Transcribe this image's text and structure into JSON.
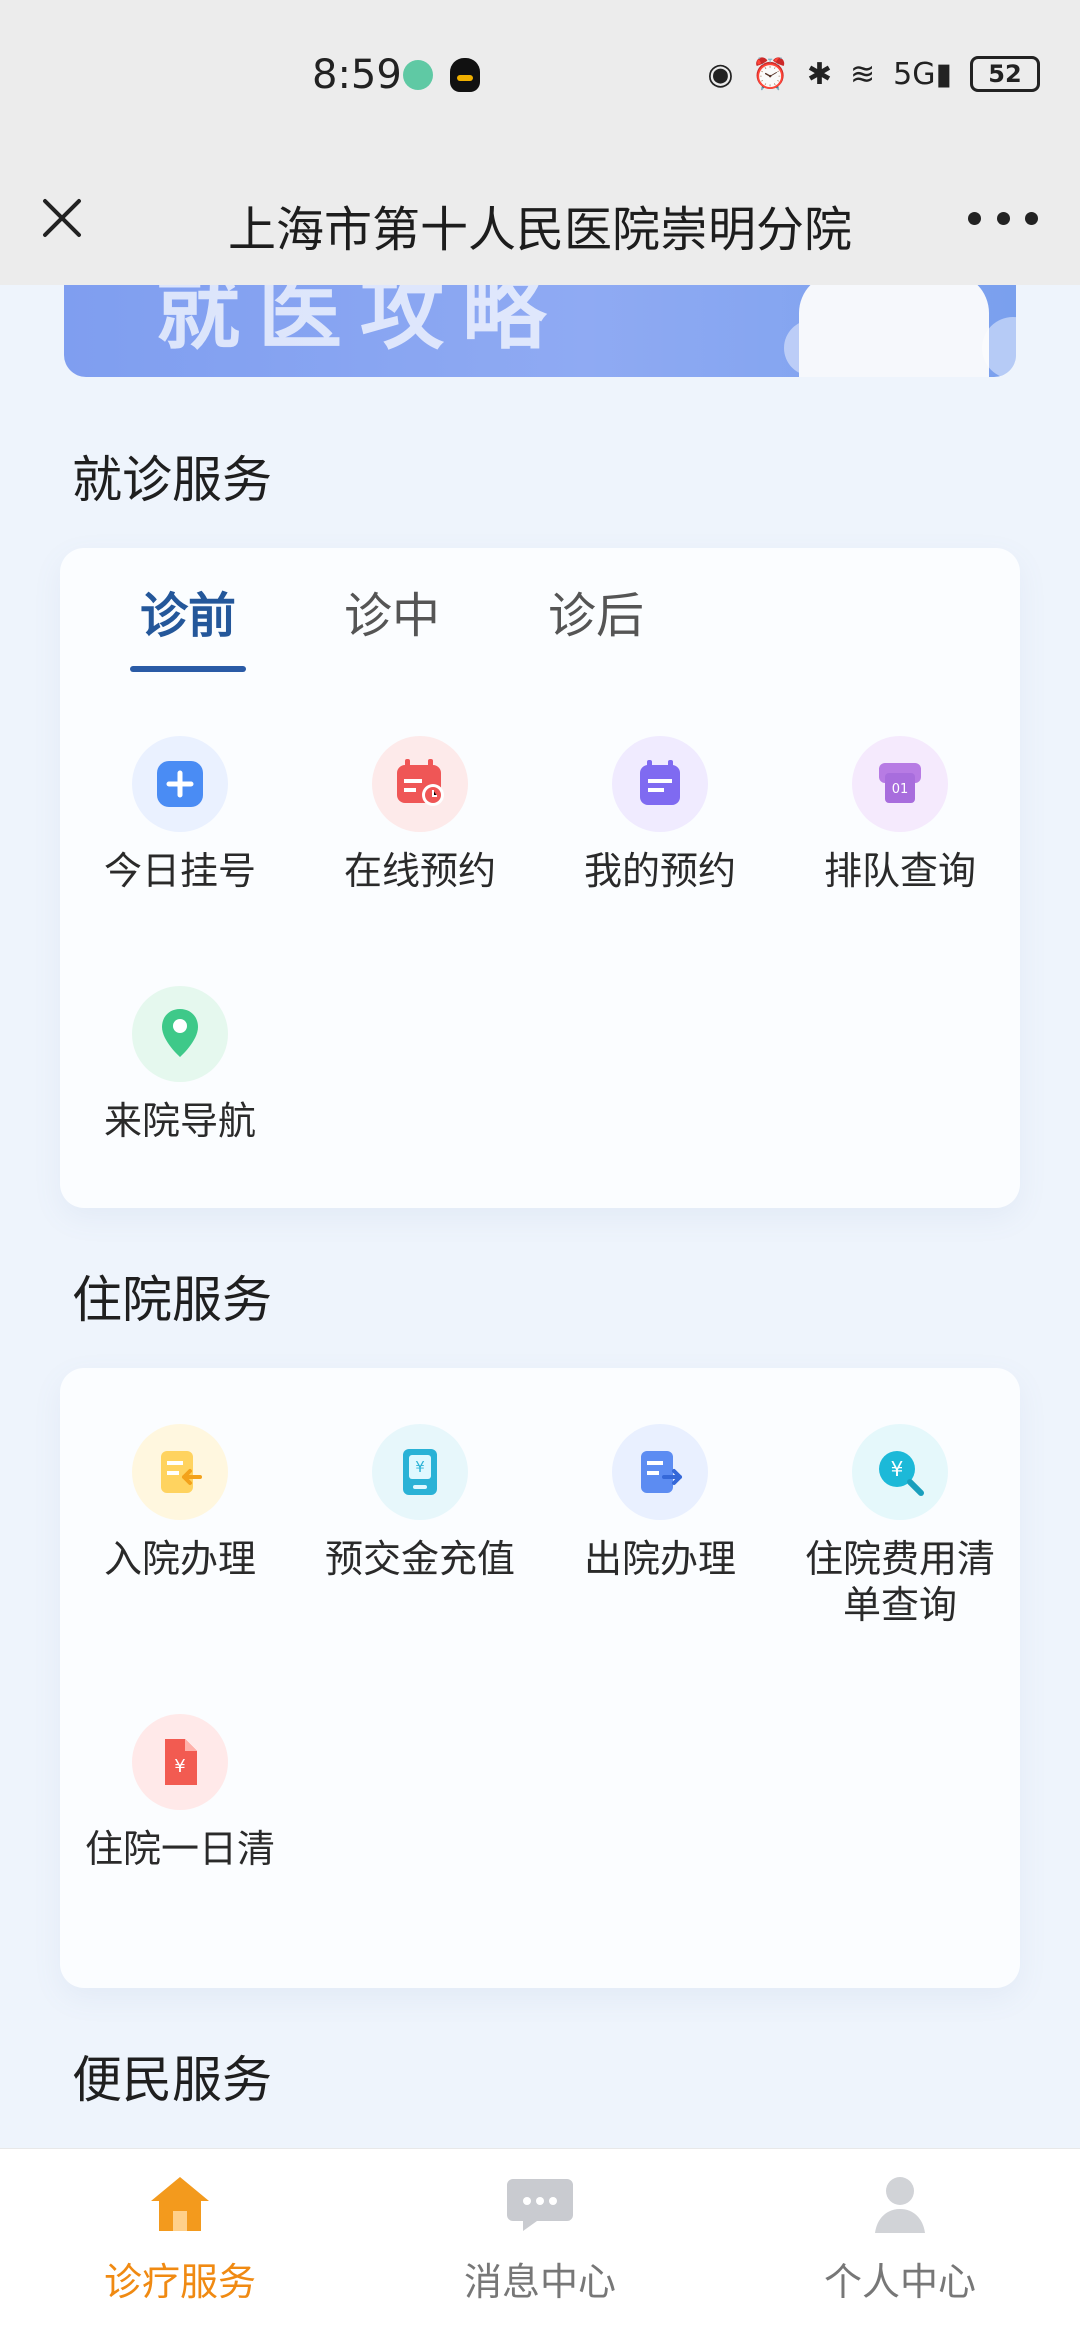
{
  "status": {
    "time": "8:59",
    "battery": "52",
    "signal": "5G"
  },
  "nav": {
    "title": "上海市第十人民医院崇明分院"
  },
  "banner": {
    "text": "就医攻略"
  },
  "sections": {
    "outpatient_title": "就诊服务",
    "inpatient_title": "住院服务",
    "convenience_title": "便民服务"
  },
  "tabs": [
    "诊前",
    "诊中",
    "诊后"
  ],
  "outpatient_items": [
    {
      "label": "今日挂号",
      "icon": "plus-icon"
    },
    {
      "label": "在线预约",
      "icon": "calendar-clock-icon"
    },
    {
      "label": "我的预约",
      "icon": "calendar-list-icon"
    },
    {
      "label": "排队查询",
      "icon": "queue-ticket-icon"
    },
    {
      "label": "来院导航",
      "icon": "location-pin-icon"
    }
  ],
  "inpatient_items": [
    {
      "label": "入院办理",
      "icon": "admission-document-icon"
    },
    {
      "label": "预交金充值",
      "icon": "deposit-recharge-icon"
    },
    {
      "label": "出院办理",
      "icon": "discharge-document-icon"
    },
    {
      "label": "住院费用清单查询",
      "icon": "fee-search-icon"
    },
    {
      "label": "住院一日清",
      "icon": "daily-bill-icon"
    }
  ],
  "bottom_tabs": [
    {
      "label": "诊疗服务",
      "icon": "home-icon"
    },
    {
      "label": "消息中心",
      "icon": "message-icon"
    },
    {
      "label": "个人中心",
      "icon": "user-icon"
    }
  ]
}
